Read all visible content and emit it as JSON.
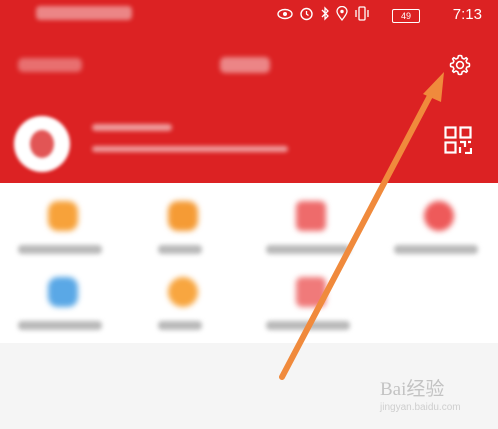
{
  "status_bar": {
    "time": "7:13",
    "battery": "49",
    "icons": [
      "eye-icon",
      "alarm-icon",
      "bluetooth-icon",
      "location-icon",
      "vibrate-icon"
    ]
  },
  "header": {
    "settings_icon": "gear-icon",
    "qr_icon": "qr-code-icon",
    "background_color": "#dc2223"
  },
  "annotation": {
    "arrow_color": "#f08a3c"
  },
  "watermark": {
    "brand": "Bai经验",
    "url": "jingyan.baidu.com"
  }
}
